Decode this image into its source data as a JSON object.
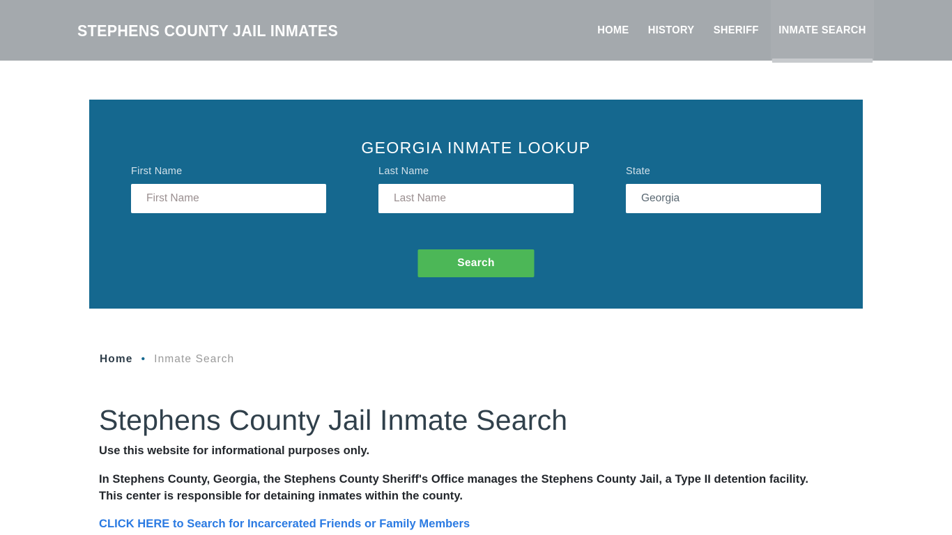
{
  "header": {
    "brand": "Stephens County Jail Inmates",
    "background_color": "#a4a9ad",
    "nav": [
      {
        "label": "Home",
        "active": false
      },
      {
        "label": "History",
        "active": false
      },
      {
        "label": "Sheriff",
        "active": false
      },
      {
        "label": "Inmate Search",
        "active": true
      }
    ]
  },
  "lookup": {
    "title": "Georgia Inmate Lookup",
    "panel_color": "#15688f",
    "fields": {
      "first_name": {
        "label": "First Name",
        "placeholder": "First Name",
        "value": ""
      },
      "last_name": {
        "label": "Last Name",
        "placeholder": "Last Name",
        "value": ""
      },
      "state": {
        "label": "State",
        "value": "Georgia",
        "options": [
          "Georgia"
        ]
      }
    },
    "search_button": {
      "label": "Search",
      "color": "#4cb757"
    }
  },
  "breadcrumb": {
    "home": "Home",
    "separator": "•",
    "current": "Inmate Search"
  },
  "main": {
    "title": "Stephens County Jail Inmate Search",
    "lead": "Use this website for informational purposes only.",
    "paragraph": "In Stephens County, Georgia, the Stephens County Sheriff's Office manages the Stephens County Jail, a Type II detention facility. This center is responsible for detaining inmates within the county.",
    "cta_link": "CLICK HERE to Search for Incarcerated Friends or Family Members",
    "link_color": "#2a7ae2"
  }
}
